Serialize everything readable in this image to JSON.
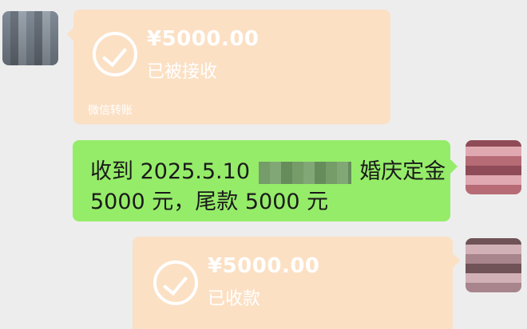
{
  "messages": [
    {
      "type": "transfer",
      "amount": "¥5000.00",
      "status": "已被接收",
      "label": "微信转账"
    },
    {
      "type": "text",
      "line1_prefix": "收到 2025.5.10",
      "line1_suffix": "婚庆定金",
      "line2": "5000 元，尾款 5000 元"
    },
    {
      "type": "transfer",
      "amount": "¥5000.00",
      "status": "已收款"
    }
  ],
  "colors": {
    "background": "#ededed",
    "transfer_bubble": "#fbe0c4",
    "text_bubble": "#95ec69"
  }
}
